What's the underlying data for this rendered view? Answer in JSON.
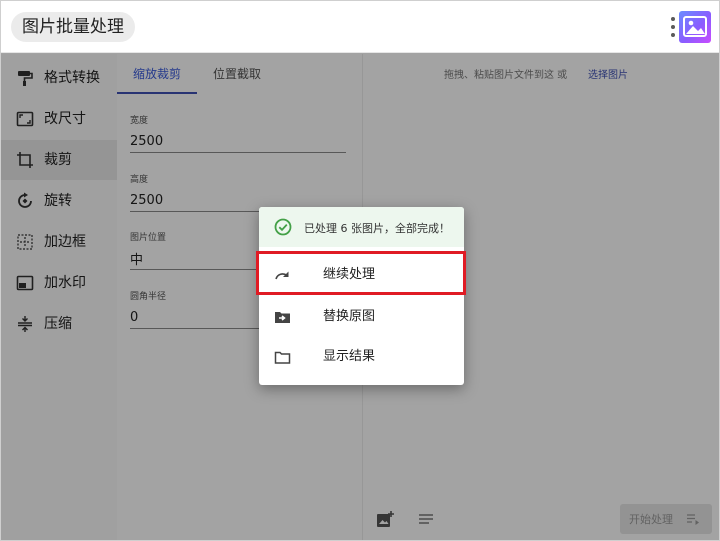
{
  "app": {
    "title": "图片批量处理",
    "accent_color": "#3f51b5"
  },
  "sidebar": {
    "items": [
      {
        "label": "格式转换",
        "icon": "paint-roller-icon"
      },
      {
        "label": "改尺寸",
        "icon": "aspect-ratio-icon"
      },
      {
        "label": "裁剪",
        "icon": "crop-icon",
        "active": true
      },
      {
        "label": "旋转",
        "icon": "rotate-icon"
      },
      {
        "label": "加边框",
        "icon": "border-icon"
      },
      {
        "label": "加水印",
        "icon": "watermark-icon"
      },
      {
        "label": "压缩",
        "icon": "compress-icon"
      }
    ]
  },
  "main": {
    "tabs": [
      {
        "label": "缩放裁剪",
        "active": true
      },
      {
        "label": "位置截取",
        "active": false
      }
    ],
    "fields": {
      "width": {
        "label": "宽度",
        "value": "2500"
      },
      "height": {
        "label": "高度",
        "value": "2500"
      },
      "position": {
        "label": "图片位置",
        "value": "中"
      },
      "radius": {
        "label": "圆角半径",
        "value": "0"
      }
    }
  },
  "drop_area": {
    "hint": "拖拽、粘贴图片文件到这 或",
    "link": "选择图片",
    "start_button": "开始处理"
  },
  "dialog": {
    "message": "已处理 6 张图片，全部完成！",
    "success_color": "#43a047",
    "items": [
      {
        "label": "继续处理",
        "icon": "redo-arrow-icon",
        "highlighted": true
      },
      {
        "label": "替换原图",
        "icon": "folder-move-icon"
      },
      {
        "label": "显示结果",
        "icon": "folder-icon"
      }
    ],
    "highlight_color": "#e01b24"
  }
}
